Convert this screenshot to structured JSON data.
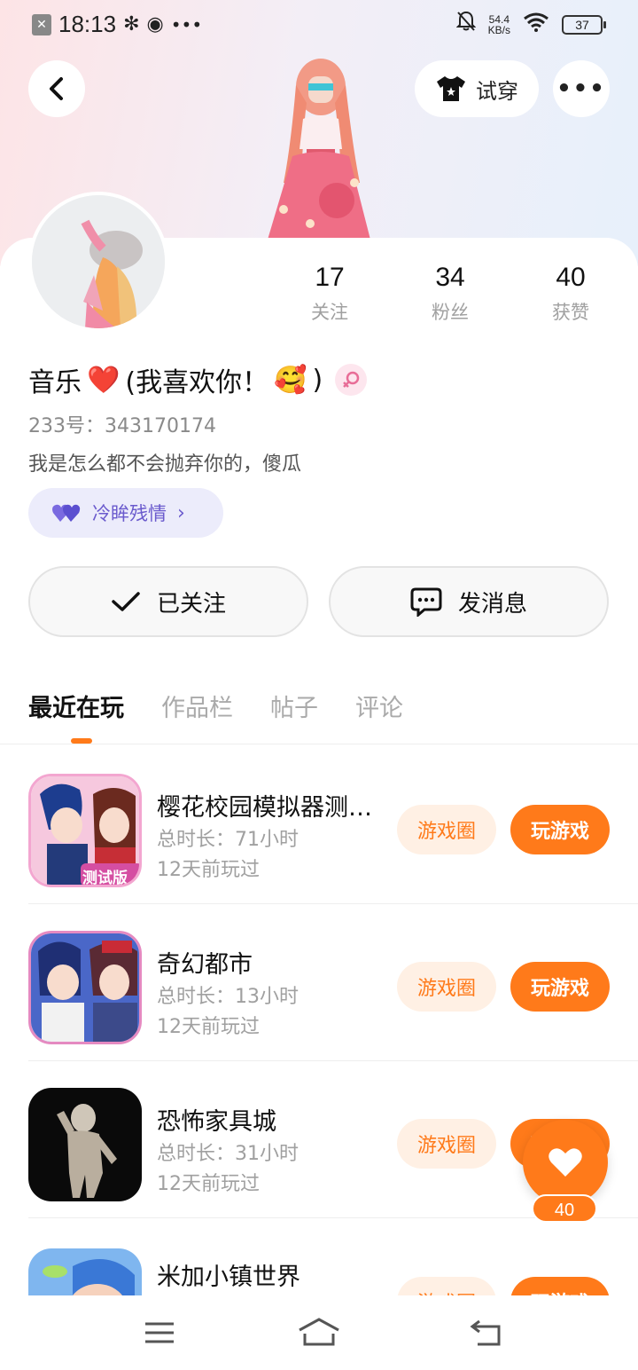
{
  "status_bar": {
    "time": "18:13",
    "net_speed_value": "54.4",
    "net_speed_unit": "KB/s",
    "battery": "37"
  },
  "header": {
    "try_on_label": "试穿"
  },
  "profile": {
    "stats": [
      {
        "value": "17",
        "label": "关注"
      },
      {
        "value": "34",
        "label": "粉丝"
      },
      {
        "value": "40",
        "label": "获赞"
      }
    ],
    "username_text": "音乐",
    "username_heart": "❤️",
    "username_paren": "(我喜欢你！",
    "username_emoji": "🥰",
    "username_close": ")",
    "uid": "233号：343170174",
    "bio": "我是怎么都不会抛弃你的，傻瓜",
    "tag_label": "冷眸残情"
  },
  "actions": {
    "followed_label": "已关注",
    "message_label": "发消息"
  },
  "tabs": [
    "最近在玩",
    "作品栏",
    "帖子",
    "评论"
  ],
  "games": [
    {
      "name": "樱花校园模拟器测试版",
      "duration": "总时长：71小时",
      "last_played": "12天前玩过",
      "circle_label": "游戏圈",
      "play_label": "玩游戏"
    },
    {
      "name": "奇幻都市",
      "duration": "总时长：13小时",
      "last_played": "12天前玩过",
      "circle_label": "游戏圈",
      "play_label": "玩游戏"
    },
    {
      "name": "恐怖家具城",
      "duration": "总时长：31小时",
      "last_played": "12天前玩过",
      "circle_label": "游戏圈",
      "play_label": "玩游戏"
    },
    {
      "name": "米加小镇世界",
      "duration": "",
      "last_played": "",
      "circle_label": "游戏圈",
      "play_label": "玩游戏"
    }
  ],
  "icon_labels": {
    "game_1_badge": "测试版"
  },
  "floating_like": {
    "count": "40"
  },
  "colors": {
    "accent": "#ff7a1a",
    "accent_light": "#fff0e4",
    "tag_purple": "#6a5acd"
  }
}
